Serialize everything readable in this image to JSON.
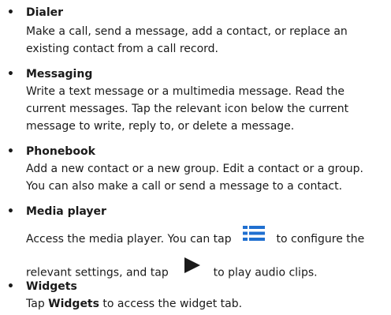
{
  "items": [
    {
      "title": "Dialer",
      "lines": [
        "Make a call, send a message, add a contact, or replace an",
        "existing contact from a call record."
      ]
    },
    {
      "title": "Messaging",
      "lines": [
        "Write a text message or a multimedia message. Read the",
        "current messages. Tap the relevant icon below the current",
        "message to write, reply to, or delete a message."
      ]
    },
    {
      "title": "Phonebook",
      "lines": [
        "Add a new contact or a new group. Edit a contact or a group.",
        "You can also make a call or send a message to a contact."
      ]
    },
    {
      "title": "Media player",
      "line1_before": "Access the media player. You can tap",
      "line1_after": "to configure the",
      "line2_before": "relevant settings, and tap",
      "line2_after": "to play audio clips."
    },
    {
      "title": "Widgets",
      "tap_word": "Tap",
      "bold_word": "Widgets",
      "rest": "to access the widget tab."
    }
  ],
  "icons": {
    "menu_icon": "menu-list-icon",
    "play_icon": "play-icon",
    "icon_color": "#1a1a1a"
  },
  "bullet": "•"
}
